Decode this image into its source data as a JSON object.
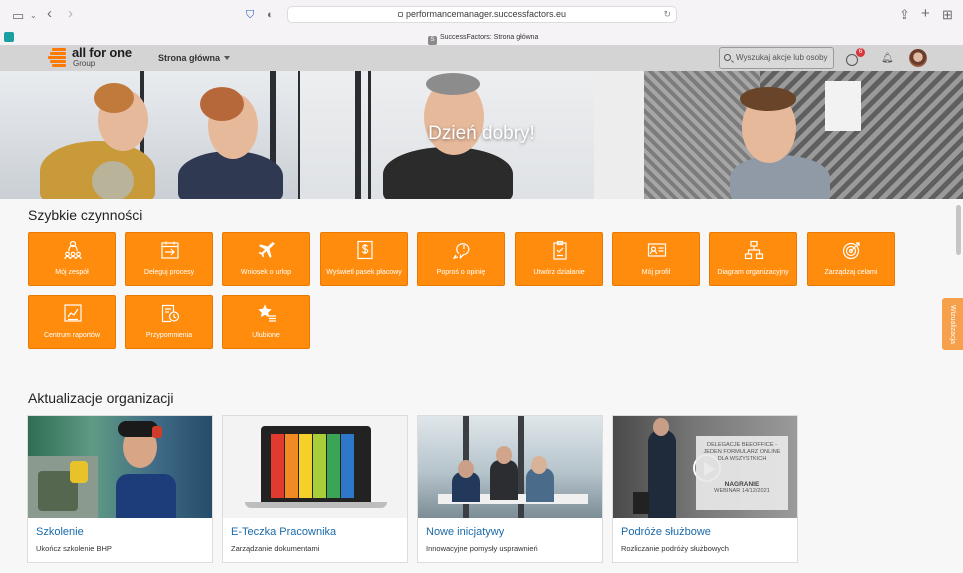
{
  "browser": {
    "url": "performancemanager.successfactors.eu",
    "tab_title": "SuccessFactors: Strona główna",
    "tab_favicon": "S"
  },
  "header": {
    "logo_text": "all for one",
    "logo_sub": "Group",
    "nav_home": "Strona główna",
    "search_placeholder": "Wyszukaj akcje lub osoby",
    "notification_count": "6",
    "accent_color": "#ff8c0d"
  },
  "hero": {
    "greeting": "Dzień dobry!"
  },
  "quick_actions": {
    "title": "Szybkie czynności",
    "items": [
      {
        "label": "Mój zespół",
        "icon": "team-icon"
      },
      {
        "label": "Deleguj procesy",
        "icon": "delegate-icon"
      },
      {
        "label": "Wniosek o urlop",
        "icon": "airplane-icon"
      },
      {
        "label": "Wyświetl pasek płacowy",
        "icon": "payslip-icon"
      },
      {
        "label": "Poproś o opinię",
        "icon": "feedback-icon"
      },
      {
        "label": "Utwórz działanie",
        "icon": "clipboard-icon"
      },
      {
        "label": "Mój profil",
        "icon": "profile-card-icon"
      },
      {
        "label": "Diagram organizacyjny",
        "icon": "org-chart-icon"
      },
      {
        "label": "Zarządzaj celami",
        "icon": "target-icon"
      },
      {
        "label": "Centrum raportów",
        "icon": "report-icon"
      },
      {
        "label": "Przypomnienia",
        "icon": "reminder-icon"
      },
      {
        "label": "Ulubione",
        "icon": "star-list-icon"
      }
    ]
  },
  "side_tab": {
    "label": "Wizualizacja"
  },
  "org_updates": {
    "title": "Aktualizacje organizacji",
    "cards": [
      {
        "title": "Szkolenie",
        "desc": "Ukończ szkolenie BHP",
        "image": "workshop-photo"
      },
      {
        "title": "E-Teczka Pracownika",
        "desc": "Zarządzanie dokumentami",
        "image": "laptop-folders-photo"
      },
      {
        "title": "Nowe inicjatywy",
        "desc": "Innowacyjne pomysły usprawnień",
        "image": "meeting-photo"
      },
      {
        "title": "Podróże służbowe",
        "desc": "Rozliczanie podróży służbowych",
        "image": "travel-video-thumbnail",
        "video_lines": [
          "DELEGACJE BEEOFFICE -",
          "JEDEN FORMULARZ ONLINE",
          "DLA WSZYSTKICH",
          "NAGRANIE",
          "WEBINAR 14/12/2021"
        ]
      }
    ]
  }
}
